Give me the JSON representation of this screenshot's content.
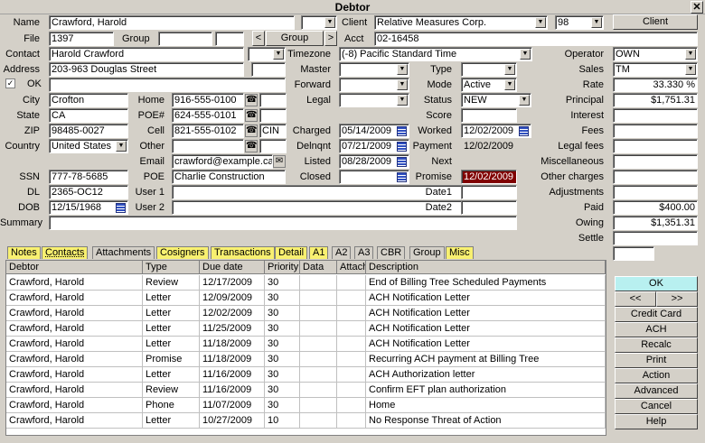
{
  "window": {
    "title": "Debtor",
    "close": "✕"
  },
  "labels": {
    "name": "Name",
    "file": "File",
    "group": "Group",
    "contact": "Contact",
    "address": "Address",
    "ok": "OK",
    "city": "City",
    "state": "State",
    "zip": "ZIP",
    "country": "Country",
    "ssn": "SSN",
    "dl": "DL",
    "dob": "DOB",
    "summary": "Summary",
    "home": "Home",
    "poe_num": "POE#",
    "cell": "Cell",
    "other": "Other",
    "email": "Email",
    "poe": "POE",
    "user1": "User 1",
    "user2": "User 2",
    "client": "Client",
    "acct": "Acct",
    "timezone": "Timezone",
    "master": "Master",
    "forward": "Forward",
    "legal": "Legal",
    "charged": "Charged",
    "delnqnt": "Delnqnt",
    "listed": "Listed",
    "closed": "Closed",
    "type": "Type",
    "mode": "Mode",
    "status": "Status",
    "score": "Score",
    "worked": "Worked",
    "payment": "Payment",
    "next": "Next",
    "promise": "Promise",
    "date1": "Date1",
    "date2": "Date2",
    "operator": "Operator",
    "sales": "Sales",
    "rate": "Rate",
    "principal": "Principal",
    "interest": "Interest",
    "fees": "Fees",
    "legal_fees": "Legal fees",
    "miscellaneous": "Miscellaneous",
    "other_charges": "Other charges",
    "adjustments": "Adjustments",
    "paid": "Paid",
    "owing": "Owing",
    "settle": "Settle"
  },
  "values": {
    "name": "Crawford, Harold",
    "file": "1397",
    "contact": "Harold Crawford",
    "address": "203-963 Douglas Street",
    "city": "Crofton",
    "state": "CA",
    "zip": "98485-0027",
    "country": "United States",
    "ssn": "777-78-5685",
    "dl": "2365-OC12",
    "dob": "12/15/1968",
    "home": "916-555-0100",
    "poe_num": "624-555-0101",
    "cell": "821-555-0102",
    "cell_carrier": "CIN",
    "email": "crawford@example.ca",
    "poe": "Charlie Construction",
    "client": "Relative Measures Corp.",
    "client_code": "98",
    "acct": "02-16458",
    "timezone": "(-8) Pacific Standard Time",
    "mode": "Active",
    "status": "NEW",
    "charged": "05/14/2009",
    "delnqnt": "07/21/2009",
    "listed": "08/28/2009",
    "worked": "12/02/2009",
    "payment": "12/02/2009",
    "promise": "12/02/2009",
    "operator": "OWN",
    "sales": "TM",
    "rate": "33.330",
    "rate_unit": "%",
    "principal": "$1,751.31",
    "paid": "$400.00",
    "owing": "$1,351.31"
  },
  "buttons": {
    "client": "Client",
    "group": "Group",
    "prev": "<",
    "next": ">",
    "ok": "OK",
    "back": "<<",
    "forward": ">>",
    "credit_card": "Credit Card",
    "ach": "ACH",
    "recalc": "Recalc",
    "print": "Print",
    "action": "Action",
    "advanced": "Advanced",
    "cancel": "Cancel",
    "help": "Help"
  },
  "tabs": [
    "Notes",
    "Contacts",
    "Attachments",
    "Cosigners",
    "Transactions",
    "Detail",
    "A1",
    "A2",
    "A3",
    "CBR",
    "Group",
    "Misc"
  ],
  "grid": {
    "headers": [
      "Debtor",
      "Type",
      "Due date",
      "Priority",
      "Data",
      "Attach",
      "Description"
    ],
    "rows": [
      [
        "Crawford, Harold",
        "Review",
        "12/17/2009",
        "30",
        "",
        "",
        "End of Billing Tree Scheduled Payments"
      ],
      [
        "Crawford, Harold",
        "Letter",
        "12/09/2009",
        "30",
        "",
        "",
        "ACH Notification Letter"
      ],
      [
        "Crawford, Harold",
        "Letter",
        "12/02/2009",
        "30",
        "",
        "",
        "ACH Notification Letter"
      ],
      [
        "Crawford, Harold",
        "Letter",
        "11/25/2009",
        "30",
        "",
        "",
        "ACH Notification Letter"
      ],
      [
        "Crawford, Harold",
        "Letter",
        "11/18/2009",
        "30",
        "",
        "",
        "ACH Notification Letter"
      ],
      [
        "Crawford, Harold",
        "Promise",
        "11/18/2009",
        "30",
        "",
        "",
        "Recurring ACH payment at Billing Tree"
      ],
      [
        "Crawford, Harold",
        "Letter",
        "11/16/2009",
        "30",
        "",
        "",
        "ACH Authorization letter"
      ],
      [
        "Crawford, Harold",
        "Review",
        "11/16/2009",
        "30",
        "",
        "",
        "Confirm EFT plan authorization"
      ],
      [
        "Crawford, Harold",
        "Phone",
        "11/07/2009",
        "30",
        "",
        "",
        "Home"
      ],
      [
        "Crawford, Harold",
        "Letter",
        "10/27/2009",
        "10",
        "",
        "",
        "No Response Threat of Action"
      ]
    ]
  },
  "colors": {
    "promise_bg": "#800000",
    "ok_button": "#b8f0f0",
    "tab_yellow": "#f8f070"
  }
}
